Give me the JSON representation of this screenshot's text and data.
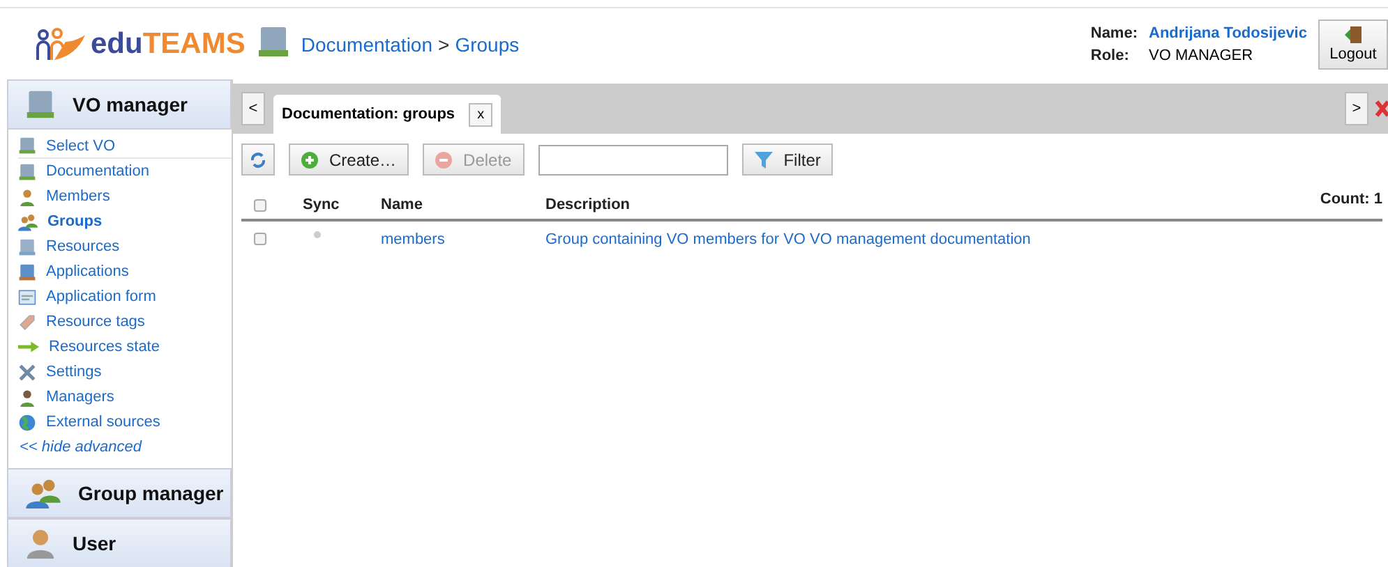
{
  "header": {
    "logo_parts": [
      "edu",
      "TEAMS"
    ],
    "breadcrumb": [
      "Documentation",
      ">",
      "Groups"
    ],
    "user": {
      "name_label": "Name:",
      "name": "Andrijana Todosijevic",
      "role_label": "Role:",
      "role": "VO MANAGER"
    },
    "logout": "Logout"
  },
  "sidebar": {
    "sections": [
      {
        "title": "VO manager",
        "expanded": true,
        "items": [
          {
            "label": "Select VO",
            "selected": false
          },
          {
            "label": "Documentation",
            "selected": false
          },
          {
            "label": "Members",
            "selected": false
          },
          {
            "label": "Groups",
            "selected": true
          },
          {
            "label": "Resources",
            "selected": false
          },
          {
            "label": "Applications",
            "selected": false
          },
          {
            "label": "Application form",
            "selected": false
          },
          {
            "label": "Resource tags",
            "selected": false
          },
          {
            "label": "Resources state",
            "selected": false
          },
          {
            "label": "Settings",
            "selected": false
          },
          {
            "label": "Managers",
            "selected": false
          },
          {
            "label": "External sources",
            "selected": false
          }
        ],
        "toggle": "<< hide advanced"
      },
      {
        "title": "Group manager",
        "expanded": false
      },
      {
        "title": "User",
        "expanded": false
      }
    ]
  },
  "tabbar": {
    "prev": "<",
    "next": ">",
    "tabs": [
      {
        "label": "Documentation: groups",
        "selected": true,
        "close": "x"
      }
    ]
  },
  "toolbar": {
    "create": "Create…",
    "delete": {
      "label": "Delete",
      "disabled": true
    },
    "filter": "Filter"
  },
  "table": {
    "select_all_checked": false,
    "count": "Count: 1",
    "columns": [
      "Sync",
      "Name",
      "Description"
    ],
    "rows": [
      {
        "checked": false,
        "name": "members",
        "description": "Group containing VO members for VO VO management documentation"
      }
    ]
  }
}
